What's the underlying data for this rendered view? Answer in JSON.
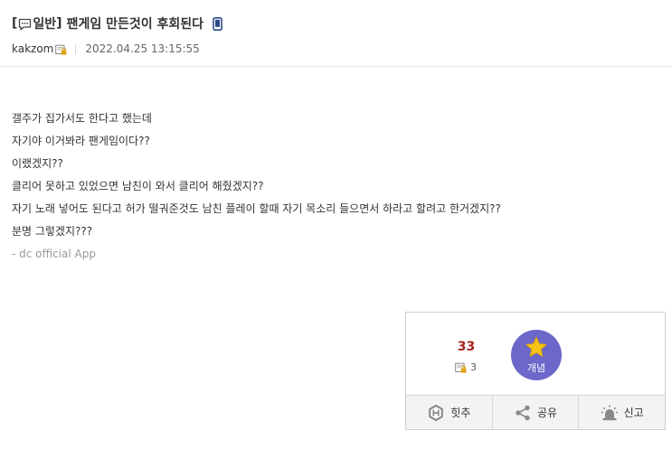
{
  "post": {
    "title_open": "[",
    "category": "일반",
    "title_close": "]",
    "title": "팬게임 만든것이 후회된다",
    "writer": "kakzom",
    "date": "2022.04.25 13:15:55"
  },
  "content": {
    "lines": [
      "갤주가 집가서도 한다고 했는데",
      "자기야 이거봐라 팬게임이다??",
      "이랬겠지??",
      "클리어 못하고 있었으면 남친이 와서 클리어 해줬겠지??",
      "자기 노래 넣어도 된다고 허가 떨궈준것도 남친 플레이 할때 자기 목소리 들으면서 하라고 할려고 한거겠지??",
      "분명 그렇겠지???"
    ],
    "app_signature": "- dc official App"
  },
  "recommend": {
    "up_count": "33",
    "fixed_up_count": "3",
    "up_label": "개념",
    "hit_label": "힛추",
    "share_label": "공유",
    "report_label": "신고"
  },
  "colors": {
    "up_count": "#a5241e",
    "up_button": "#6c67c8",
    "star": "#f5c518",
    "mobile_icon": "#2b4a8a"
  },
  "icons": {
    "speech": "speech-bubble-icon",
    "mobile": "mobile-phone-icon",
    "fixed_nick": "fixed-nick-icon",
    "star": "star-icon",
    "hit": "hit-badge-icon",
    "share": "share-icon",
    "report": "siren-icon"
  }
}
